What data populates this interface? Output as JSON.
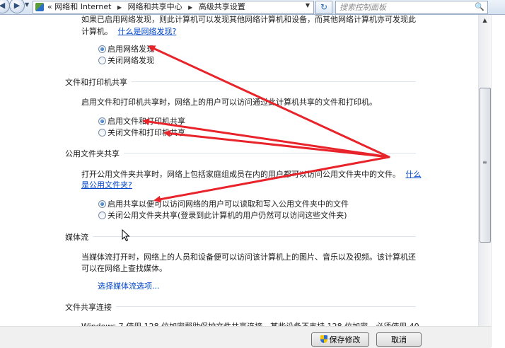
{
  "address_bar": {
    "breadcrumbs": [
      "«",
      "网络和 Internet",
      "网络和共享中心",
      "高级共享设置"
    ],
    "search_placeholder": "搜索控制面板"
  },
  "network_discovery": {
    "intro_line1": "如果已启用网络发现，则此计算机可以发现其他网络计算机和设备，而其他网络计算机亦可发现此",
    "intro_line2": "计算机。",
    "link": "什么是网络发现?",
    "options": [
      {
        "label": "启用网络发现",
        "selected": true
      },
      {
        "label": "关闭网络发现",
        "selected": false
      }
    ]
  },
  "file_printer_sharing": {
    "heading": "文件和打印机共享",
    "description": "启用文件和打印机共享时，网络上的用户可以访问通过此计算机共享的文件和打印机。",
    "options": [
      {
        "label": "启用文件和打印机共享",
        "selected": true
      },
      {
        "label": "关闭文件和打印机共享",
        "selected": false
      }
    ]
  },
  "public_folder_sharing": {
    "heading": "公用文件夹共享",
    "description": "打开公用文件夹共享时，网络上包括家庭组成员在内的用户都可以访问公用文件夹中的文件。",
    "link_part1": "什么",
    "link_part2": "是公用文件夹?",
    "options": [
      {
        "label": "启用共享以便可以访问网络的用户可以读取和写入公用文件夹中的文件",
        "selected": true
      },
      {
        "label": "关闭公用文件夹共享(登录到此计算机的用户仍然可以访问这些文件夹)",
        "selected": false
      }
    ]
  },
  "media_streaming": {
    "heading": "媒体流",
    "description_line1": "当媒体流打开时，网络上的人员和设备便可以访问该计算机上的图片、音乐以及视频。该计算机还",
    "description_line2": "可以在网络上查找媒体。",
    "link": "选择媒体流选项..."
  },
  "file_sharing_connections": {
    "heading": "文件共享连接",
    "description_partial": "Windows 7 使用 128 位加密帮助保护文件共享连接。某些设备不支持 128 位加密，必须使用 40"
  },
  "footer": {
    "save_label": "保存修改",
    "cancel_label": "取消"
  },
  "annotation_color": "#e8232a"
}
